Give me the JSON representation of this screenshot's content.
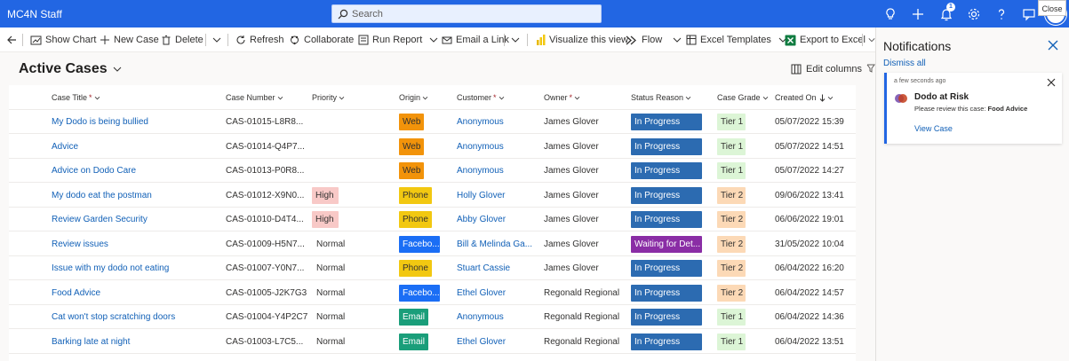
{
  "app": {
    "title": "MC4N Staff",
    "search_placeholder": "Search",
    "notification_count": "1",
    "close_tooltip": "Close"
  },
  "colors": {
    "topbar": "#2266e3",
    "link": "#1160b7"
  },
  "commands": [
    {
      "label": "Show Chart",
      "icon": "chart-icon"
    },
    {
      "label": "New Case",
      "icon": "plus-icon"
    },
    {
      "label": "Delete",
      "icon": "trash-icon"
    },
    {
      "label": "Refresh",
      "icon": "refresh-icon"
    },
    {
      "label": "Collaborate",
      "icon": "collaborate-icon"
    },
    {
      "label": "Run Report",
      "icon": "report-icon"
    },
    {
      "label": "Email a Link",
      "icon": "mail-icon"
    },
    {
      "label": "Visualize this view",
      "icon": "powerbi-icon"
    },
    {
      "label": "Flow",
      "icon": "flow-icon"
    },
    {
      "label": "Excel Templates",
      "icon": "excel-template-icon"
    },
    {
      "label": "Export to Excel",
      "icon": "excel-icon"
    }
  ],
  "view": {
    "title": "Active Cases",
    "edit_columns": "Edit columns"
  },
  "columns": [
    "Case Title",
    "Case Number",
    "Priority",
    "Origin",
    "Customer",
    "Owner",
    "Status Reason",
    "Case Grade",
    "Created On"
  ],
  "rows": [
    {
      "title": "My Dodo is being bullied",
      "number": "CAS-01015-L8R8...",
      "priority": "",
      "origin": "Web",
      "customer": "Anonymous",
      "owner": "James Glover",
      "status": "In Progress",
      "grade": "Tier 1",
      "created": "05/07/2022 15:39"
    },
    {
      "title": "Advice",
      "number": "CAS-01014-Q4P7...",
      "priority": "",
      "origin": "Web",
      "customer": "Anonymous",
      "owner": "James Glover",
      "status": "In Progress",
      "grade": "Tier 1",
      "created": "05/07/2022 14:51"
    },
    {
      "title": "Advice on Dodo Care",
      "number": "CAS-01013-P0R8...",
      "priority": "",
      "origin": "Web",
      "customer": "Anonymous",
      "owner": "James Glover",
      "status": "In Progress",
      "grade": "Tier 1",
      "created": "05/07/2022 14:27"
    },
    {
      "title": "My dodo eat the postman",
      "number": "CAS-01012-X9N0...",
      "priority": "High",
      "origin": "Phone",
      "customer": "Holly Glover",
      "owner": "James Glover",
      "status": "In Progress",
      "grade": "Tier 2",
      "created": "09/06/2022 13:41"
    },
    {
      "title": "Review Garden Security",
      "number": "CAS-01010-D4T4...",
      "priority": "High",
      "origin": "Phone",
      "customer": "Abby Glover",
      "owner": "James Glover",
      "status": "In Progress",
      "grade": "Tier 2",
      "created": "06/06/2022 19:01"
    },
    {
      "title": "Review issues",
      "number": "CAS-01009-H5N7...",
      "priority": "Normal",
      "origin": "Facebo...",
      "customer": "Bill & Melinda Ga...",
      "owner": "James Glover",
      "status": "Waiting for Det...",
      "grade": "Tier 2",
      "created": "31/05/2022 10:04"
    },
    {
      "title": "Issue with my dodo not eating",
      "number": "CAS-01007-Y0N7...",
      "priority": "Normal",
      "origin": "Phone",
      "customer": "Stuart Cassie",
      "owner": "James Glover",
      "status": "In Progress",
      "grade": "Tier 2",
      "created": "06/04/2022 16:20"
    },
    {
      "title": "Food Advice",
      "number": "CAS-01005-J2K7G3",
      "priority": "Normal",
      "origin": "Facebo...",
      "customer": "Ethel Glover",
      "owner": "Regonald Regional",
      "status": "In Progress",
      "grade": "Tier 2",
      "created": "06/04/2022 14:57"
    },
    {
      "title": "Cat won't stop scratching doors",
      "number": "CAS-01004-Y4P2C7",
      "priority": "Normal",
      "origin": "Email",
      "customer": "Anonymous",
      "owner": "Regonald Regional",
      "status": "In Progress",
      "grade": "Tier 1",
      "created": "06/04/2022 14:36"
    },
    {
      "title": "Barking late at night",
      "number": "CAS-01003-L7C5...",
      "priority": "Normal",
      "origin": "Email",
      "customer": "Ethel Glover",
      "owner": "Regonald Regional",
      "status": "In Progress",
      "grade": "Tier 1",
      "created": "06/04/2022 13:51"
    }
  ],
  "notifications": {
    "title": "Notifications",
    "dismiss_all": "Dismiss all",
    "card": {
      "time": "a few seconds ago",
      "heading": "Dodo at Risk",
      "body_prefix": "Please review this case:",
      "body_case": "Food Advice",
      "action": "View Case"
    }
  }
}
